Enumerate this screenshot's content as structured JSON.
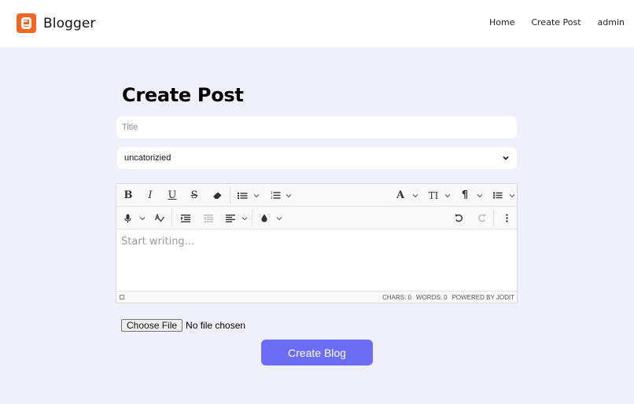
{
  "brand": {
    "name": "Blogger",
    "accent": "#f26522",
    "icon": "blogger-logo"
  },
  "nav": {
    "home": "Home",
    "create_post": "Create Post",
    "user": "admin"
  },
  "page": {
    "title": "Create Post",
    "background": "#f0effc"
  },
  "form": {
    "title_placeholder": "Title",
    "title_value": "",
    "category_value": "uncatorizied",
    "editor_placeholder": "Start writing...",
    "file_button": "Choose File",
    "file_status": "No file chosen",
    "submit_label": "Create Blog",
    "submit_color": "#6c6cf5"
  },
  "editor": {
    "toolbar": {
      "bold": "B",
      "italic": "I",
      "underline": "U",
      "strike": "S",
      "font": "A",
      "font_size": "TI",
      "paragraph": "¶"
    },
    "status": {
      "chars": "CHARS: 0",
      "words": "WORDS: 0",
      "powered": "POWERED BY JODIT"
    }
  }
}
